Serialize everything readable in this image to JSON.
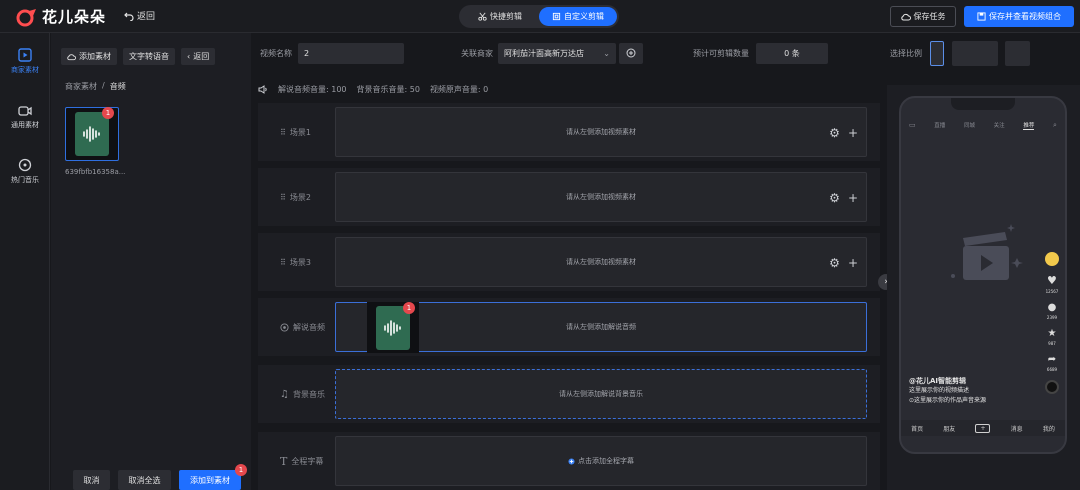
{
  "header": {
    "logo_text": "花儿朵朵",
    "back_label": "返回",
    "mode_quick": "快捷剪辑",
    "mode_custom": "自定义剪辑",
    "save_task": "保存任务",
    "save_view": "保存并查看视频组合"
  },
  "leftnav": {
    "items": [
      {
        "label": "商家素材",
        "icon": "play-square-icon",
        "active": true
      },
      {
        "label": "通用素材",
        "icon": "video-camera-icon",
        "active": false
      },
      {
        "label": "热门音乐",
        "icon": "music-disc-icon",
        "active": false
      }
    ]
  },
  "material": {
    "add_label": "添加素材",
    "tts_label": "文字转语音",
    "back_label": "返回",
    "breadcrumb_root": "商家素材",
    "breadcrumb_sep": "/",
    "breadcrumb_current": "音频",
    "asset_name": "639fbfb16358a...",
    "asset_badge": "1",
    "cancel": "取消",
    "deselect_all": "取消全选",
    "add_to_material": "添加到素材",
    "add_badge": "1"
  },
  "settings": {
    "video_name_label": "视频名称",
    "video_name_value": "2",
    "merchant_label": "关联商家",
    "merchant_value": "阿利茄汁面高新万达店",
    "estimate_label": "预计可剪辑数量",
    "estimate_value": "0 条",
    "ratio_label": "选择比例"
  },
  "volume": {
    "narration": "解说音频音量: 100",
    "bgm": "背景音乐音量: 50",
    "original": "视频原声音量: 0"
  },
  "tracks": {
    "scene1": "场景1",
    "scene2": "场景2",
    "scene3": "场景3",
    "scene_placeholder": "请从左侧添加视频素材",
    "narration_label": "解说音频",
    "narration_placeholder": "请从左侧添加解说音频",
    "narration_badge": "1",
    "bgm_label": "背景音乐",
    "bgm_placeholder": "请从左侧添加解说背景音乐",
    "subtitle_label": "全程字幕",
    "subtitle_placeholder": "点击添加全程字幕"
  },
  "phone": {
    "top_tabs": [
      "直播",
      "同城",
      "关注",
      "推荐"
    ],
    "active_tab": "推荐",
    "likes": "12567",
    "comments": "2399",
    "favorites": "987",
    "shares": "6689",
    "caption_title": "@花儿AI智能剪辑",
    "caption_desc": "这里展示你的视频描述",
    "caption_src": "⊙这里展示你的作品声音来源",
    "bottom_tabs": [
      "首页",
      "朋友",
      "+",
      "消息",
      "我的"
    ]
  },
  "colors": {
    "accent": "#1f6fff",
    "badge": "#e5484d",
    "audio_card": "#2f6b51"
  }
}
